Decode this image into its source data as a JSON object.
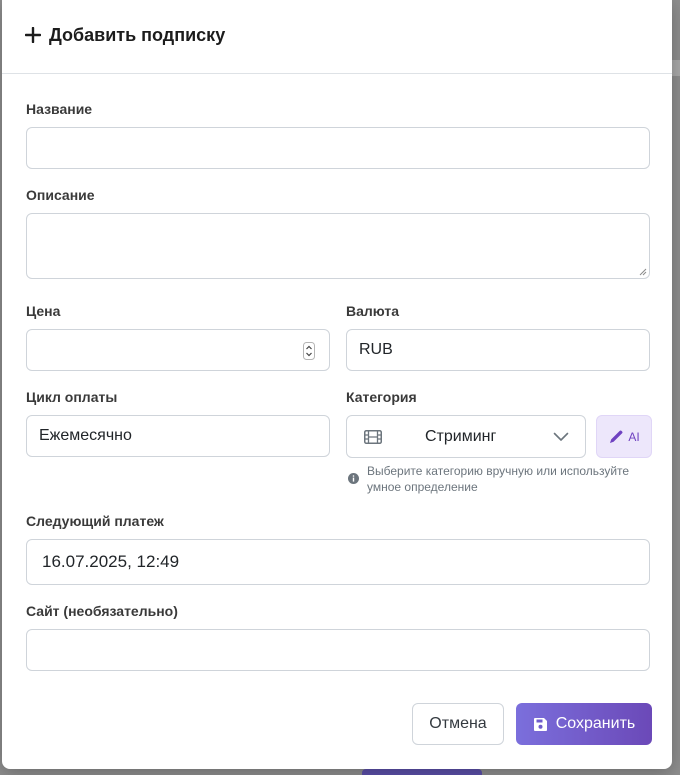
{
  "modal": {
    "title": "Добавить подписку"
  },
  "form": {
    "name": {
      "label": "Название",
      "value": ""
    },
    "description": {
      "label": "Описание",
      "value": ""
    },
    "price": {
      "label": "Цена",
      "value": ""
    },
    "currency": {
      "label": "Валюта",
      "value": "RUB"
    },
    "billing_cycle": {
      "label": "Цикл оплаты",
      "value": "Ежемесячно"
    },
    "category": {
      "label": "Категория",
      "value": "Стриминг",
      "icon": "film-icon",
      "ai_button": "AI",
      "hint": "Выберите категорию вручную или используйте умное определение"
    },
    "next_payment": {
      "label": "Следующий платеж",
      "value": "16.07.2025, 12:49"
    },
    "website": {
      "label": "Сайт (необязательно)",
      "value": ""
    }
  },
  "buttons": {
    "cancel": "Отмена",
    "save": "Сохранить"
  },
  "colors": {
    "accent": "#6f42c1",
    "save_gradient_start": "#7b6fdc",
    "save_gradient_end": "#6b49b8"
  }
}
